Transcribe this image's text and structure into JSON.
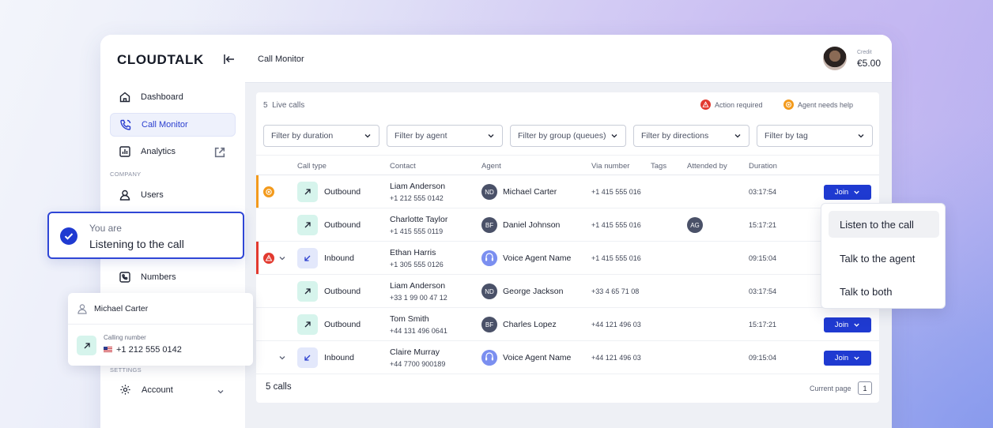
{
  "app": {
    "logo": "CLOUDTALK",
    "page_title": "Call Monitor"
  },
  "sidebar": {
    "items": [
      {
        "label": "Dashboard",
        "icon": "home-icon"
      },
      {
        "label": "Call Monitor",
        "icon": "phone-icon",
        "active": true
      },
      {
        "label": "Analytics",
        "icon": "chart-icon",
        "external": true
      },
      {
        "label": "Users",
        "icon": "user-icon"
      },
      {
        "label": "Numbers",
        "icon": "phone-square-icon"
      },
      {
        "label": "Account",
        "icon": "gear-icon"
      }
    ],
    "company_label": "COMPANY",
    "settings_label": "SETTINGS"
  },
  "header": {
    "credit_label": "Credit",
    "credit_value": "€5.00"
  },
  "monitor": {
    "live_count": "5",
    "live_label": "Live calls",
    "legend_action": "Action required",
    "legend_help": "Agent needs help",
    "filters": [
      "Filter by duration",
      "Filter by agent",
      "Filter by group (queues)",
      "Filter by directions",
      "Filter by tag"
    ],
    "columns": [
      "Call type",
      "Contact",
      "Agent",
      "Via number",
      "Tags",
      "Attended by",
      "Duration"
    ],
    "rows": [
      {
        "status": "help",
        "type": "Outbound",
        "contact": "Liam Anderson",
        "contact_number": "+1 212 555 0142",
        "agent_initials": "ND",
        "agent": "Michael Carter",
        "via": "+1 415 555 016",
        "attended": "",
        "duration": "03:17:54",
        "join": "Join"
      },
      {
        "status": "",
        "type": "Outbound",
        "contact": "Charlotte Taylor",
        "contact_number": "+1 415 555 0119",
        "agent_initials": "BF",
        "agent": "Daniel Johnson",
        "via": "+1 415 555 016",
        "attended": "AG",
        "duration": "15:17:21",
        "join": ""
      },
      {
        "status": "action",
        "type": "Inbound",
        "contact": "Ethan Harris",
        "contact_number": "+1 305 555 0126",
        "agent_initials": "AI",
        "agent": "Voice Agent Name",
        "via": "+1 415 555 016",
        "attended": "",
        "duration": "09:15:04",
        "join": ""
      },
      {
        "status": "",
        "type": "Outbound",
        "contact": "Liam Anderson",
        "contact_number": "+33 1 99 00 47 12",
        "agent_initials": "ND",
        "agent": "George Jackson",
        "via": "+33 4 65 71 08",
        "attended": "",
        "duration": "03:17:54",
        "join": ""
      },
      {
        "status": "",
        "type": "Outbound",
        "contact": "Tom Smith",
        "contact_number": "+44 131 496 0641",
        "agent_initials": "BF",
        "agent": "Charles Lopez",
        "via": "+44 121 496 03",
        "attended": "",
        "duration": "15:17:21",
        "join": "Join"
      },
      {
        "status": "",
        "type": "Inbound",
        "contact": "Claire Murray",
        "contact_number": "+44 7700 900189",
        "agent_initials": "AI",
        "agent": "Voice Agent Name",
        "via": "+44 121 496 03",
        "attended": "",
        "duration": "09:15:04",
        "join": "Join"
      }
    ],
    "footer_calls": "5 calls",
    "current_page_label": "Current page",
    "current_page": "1"
  },
  "listening_card": {
    "line1": "You are",
    "line2": "Listening to the call"
  },
  "caller_card": {
    "name": "Michael Carter",
    "calling_label": "Calling number",
    "calling_number": "+1 212 555 0142"
  },
  "join_menu": {
    "items": [
      "Listen to the call",
      "Talk to the agent",
      "Talk to both"
    ]
  },
  "colors": {
    "accent": "#1f3ad1",
    "help": "#f39a1c",
    "action": "#e23a2f",
    "outbound_bg": "#d6f4ec",
    "inbound_bg": "#e3e8fb"
  }
}
